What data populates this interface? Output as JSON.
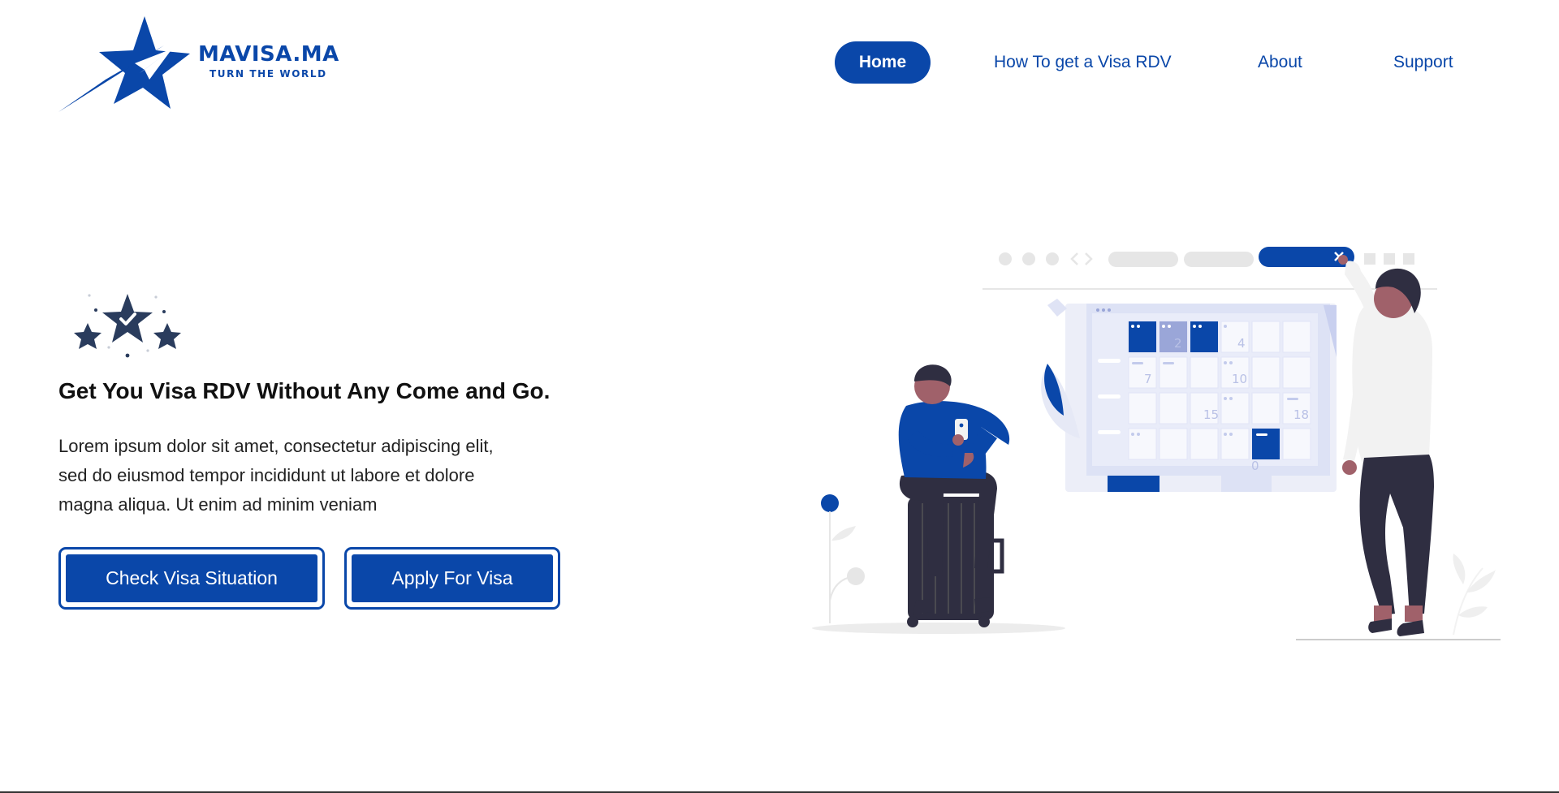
{
  "brand": {
    "name": "MAVISA.MA",
    "tagline": "TURN THE WORLD"
  },
  "nav": {
    "items": [
      {
        "label": "Home",
        "active": true
      },
      {
        "label": "How To get a Visa RDV",
        "active": false
      },
      {
        "label": "About",
        "active": false
      },
      {
        "label": "Support",
        "active": false
      }
    ]
  },
  "hero": {
    "icon": "three-stars-check-icon",
    "title": "Get You Visa RDV Without Any Come and Go.",
    "text": "Lorem ipsum dolor sit amet, consectetur adipiscing elit, sed do eiusmod tempor incididunt ut labore et dolore magna aliqua. Ut enim ad minim veniam",
    "buttons": {
      "check": "Check Visa Situation",
      "apply": "Apply For Visa"
    }
  },
  "illustration": {
    "calendar_numbers": [
      "2",
      "4",
      "7",
      "10",
      "15",
      "18",
      "0"
    ]
  },
  "colors": {
    "accent": "#0a47a9",
    "dark": "#2f2e41",
    "light": "#e6e6e6"
  }
}
